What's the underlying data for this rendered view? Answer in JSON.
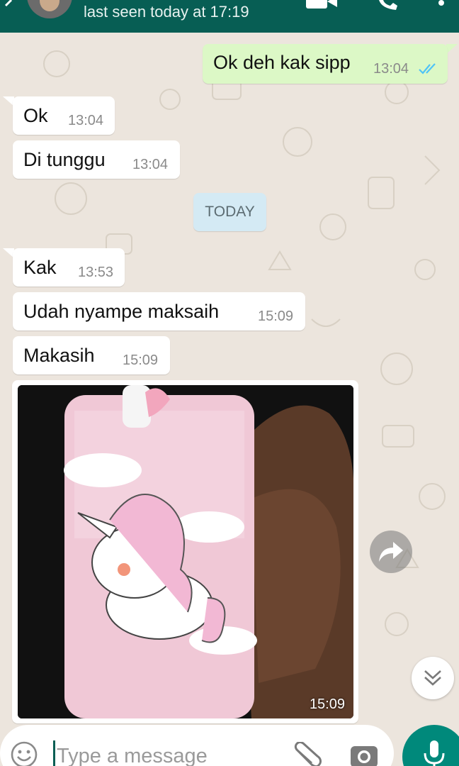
{
  "header": {
    "status": "last seen today at 17:19"
  },
  "messages": [
    {
      "direction": "out",
      "text": "Ok deh kak sipp",
      "time": "13:04",
      "ticks": "read"
    },
    {
      "direction": "in",
      "text": "Ok",
      "time": "13:04"
    },
    {
      "direction": "in",
      "text": "Di tunggu",
      "time": "13:04"
    },
    {
      "direction": "in",
      "text": "Kak",
      "time": "13:53"
    },
    {
      "direction": "in",
      "text": "Udah nyampe maksaih",
      "time": "15:09"
    },
    {
      "direction": "in",
      "text": "Makasih",
      "time": "15:09"
    }
  ],
  "date_divider": "TODAY",
  "image_message": {
    "time": "15:09"
  },
  "composer": {
    "placeholder": "Type a message"
  },
  "icons": {
    "header": [
      "back-arrow-icon",
      "avatar",
      "video-call-icon",
      "phone-icon",
      "menu-icon"
    ],
    "composer": [
      "emoji-icon",
      "attach-icon",
      "camera-icon",
      "mic-icon"
    ],
    "chat": [
      "forward-icon",
      "chevron-double-down-icon",
      "double-check-icon"
    ]
  },
  "colors": {
    "header": "#075e54",
    "outgoing_bubble": "#dcf8c6",
    "incoming_bubble": "#ffffff",
    "date_chip": "#d4eaf4",
    "accent": "#00897b",
    "read_ticks": "#4fc3f7"
  }
}
